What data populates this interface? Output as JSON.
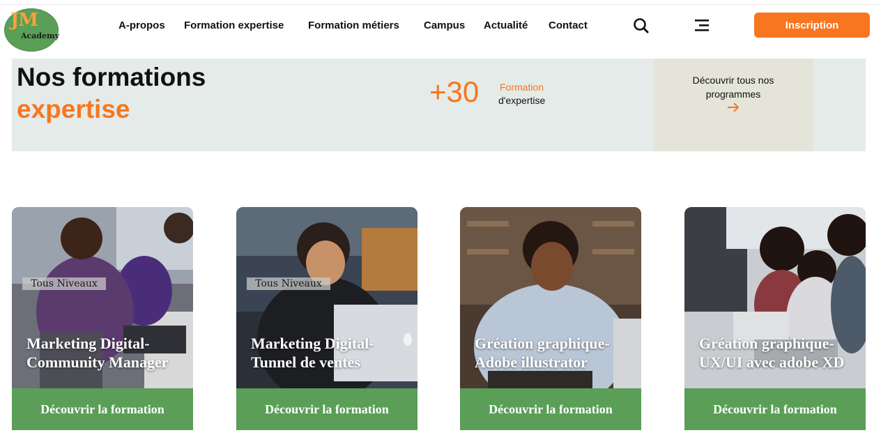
{
  "header": {
    "logo_mark": "JM",
    "logo_sub": "Academy",
    "nav": [
      "A-propos",
      "Formation expertise",
      "Formation métiers",
      "Campus",
      "Actualité",
      "Contact"
    ],
    "cta_label": "Inscription",
    "search_icon": "search-icon",
    "menu_icon": "menu-icon"
  },
  "banner": {
    "title_line1": "Nos formations",
    "title_line2": "expertise",
    "stat_value": "+30",
    "stat_label1": "Formation",
    "stat_label2": "d'expertise",
    "discover_line1": "Découvrir tous nos",
    "discover_line2": "programmes"
  },
  "cards": [
    {
      "badge": "Tous Niveaux",
      "title_line1": "Marketing Digital-",
      "title_line2": "Community Manager",
      "button": "Découvrir la formation"
    },
    {
      "badge": "Tous Niveaux",
      "title_line1": "Marketing Digital-",
      "title_line2": "Tunnel de ventes",
      "button": "Découvrir la formation"
    },
    {
      "badge": "",
      "title_line1": "Gréation graphique-",
      "title_line2": "Adobe illustrator",
      "button": "Découvrir la formation"
    },
    {
      "badge": "",
      "title_line1": "Gréation graphique-",
      "title_line2": "UX/UI avec adobe XD",
      "button": "Découvrir la formation"
    }
  ],
  "colors": {
    "accent": "#f7761f",
    "green": "#5a9e57",
    "banner_bg": "#e5ebe8",
    "discover_bg": "#e4e4d9"
  }
}
